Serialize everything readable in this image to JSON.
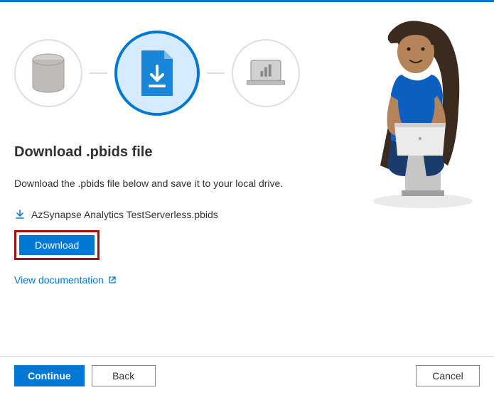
{
  "heading": "Download .pbids file",
  "description": "Download the .pbids file below and save it to your local drive.",
  "file": {
    "name": "AzSynapse Analytics TestServerless.pbids"
  },
  "buttons": {
    "download": "Download",
    "continue": "Continue",
    "back": "Back",
    "cancel": "Cancel"
  },
  "links": {
    "documentation": "View documentation"
  },
  "colors": {
    "accent": "#0078d4",
    "highlight_border": "#a30f0f"
  }
}
